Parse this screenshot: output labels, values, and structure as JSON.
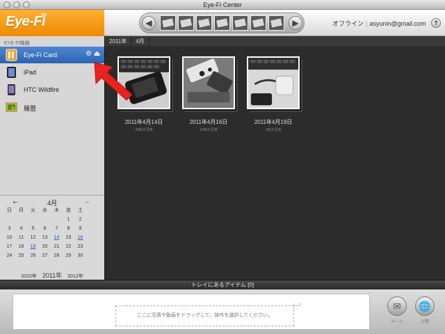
{
  "window": {
    "title": "Eye-Fi Center"
  },
  "header": {
    "logo": "Eye-Fi",
    "status": "オフライン",
    "account": "asyunin@gmail.com",
    "help": "?"
  },
  "sidebar": {
    "section": "EYE-FI機器",
    "items": [
      {
        "label": "Eye-Fi Card",
        "icon": "sd-card-icon",
        "selected": true
      },
      {
        "label": "iPad",
        "icon": "ipad-icon",
        "selected": false
      },
      {
        "label": "HTC Wildfire",
        "icon": "phone-icon",
        "selected": false
      },
      {
        "label": "履歴",
        "icon": "history-icon",
        "selected": false
      }
    ]
  },
  "calendar": {
    "month": "4月",
    "weekdays": [
      "日",
      "月",
      "火",
      "水",
      "木",
      "金",
      "土"
    ],
    "weeks": [
      [
        "",
        "",
        "",
        "",
        "",
        "1",
        "2"
      ],
      [
        "3",
        "4",
        "5",
        "6",
        "7",
        "8",
        "9"
      ],
      [
        "10",
        "11",
        "12",
        "13",
        "14",
        "15",
        "16"
      ],
      [
        "17",
        "18",
        "19",
        "20",
        "21",
        "22",
        "23"
      ],
      [
        "24",
        "25",
        "26",
        "27",
        "28",
        "29",
        "30"
      ]
    ],
    "highlighted": [
      "14",
      "16",
      "19"
    ],
    "years": {
      "prev": "2010年",
      "current": "2011年",
      "next": "2012年"
    }
  },
  "main": {
    "breadcrumb": [
      "2011年",
      "4月"
    ],
    "albums": [
      {
        "title": "2011年4月14日",
        "count": "40枚の写真"
      },
      {
        "title": "2011年4月16日",
        "count": "14枚の写真"
      },
      {
        "title": "2011年4月19日",
        "count": "2枚の写真"
      }
    ]
  },
  "tray": {
    "title": "トレイにあるアイテム [0]",
    "drop_hint": "ここに写真や動画をドラッグして、操作を選択してください。",
    "mail_label": "メール",
    "publish_label": "公開"
  },
  "colors": {
    "accent": "#f39300",
    "selection": "#3a74c4",
    "annotation": "#e8231f"
  }
}
